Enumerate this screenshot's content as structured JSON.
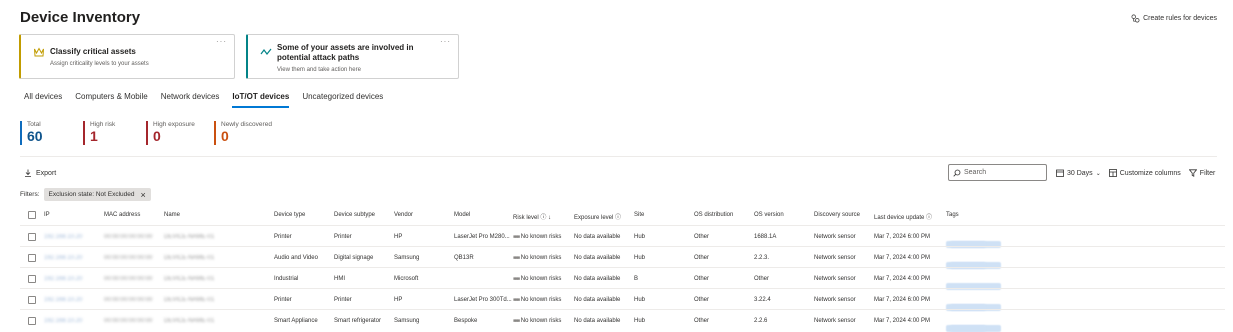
{
  "page": {
    "title": "Device Inventory",
    "create_rules": "Create rules for devices"
  },
  "cards": [
    {
      "title": "Classify critical assets",
      "subtitle": "Assign criticality levels to your assets",
      "accent": "#c19c00",
      "icon": "crown-icon"
    },
    {
      "title": "Some of your assets are involved in potential attack paths",
      "subtitle": "View them and take action here",
      "accent": "#038387",
      "icon": "attack-path-icon"
    }
  ],
  "tabs": [
    "All devices",
    "Computers & Mobile",
    "Network devices",
    "IoT/OT devices",
    "Uncategorized devices"
  ],
  "active_tab": "IoT/OT devices",
  "stats": [
    {
      "label": "Total",
      "value": "60",
      "color": "#0f548c"
    },
    {
      "label": "High risk",
      "value": "1",
      "color": "#a4262c"
    },
    {
      "label": "High exposure",
      "value": "0",
      "color": "#a4262c"
    },
    {
      "label": "Newly discovered",
      "value": "0",
      "color": "#ca5010"
    }
  ],
  "toolbar": {
    "export": "Export",
    "search_placeholder": "Search",
    "days": "30 Days",
    "customize": "Customize columns",
    "filter": "Filter"
  },
  "filters": {
    "label": "Filters:",
    "chip": "Exclusion state: Not Excluded"
  },
  "columns": [
    "IP",
    "MAC address",
    "Name",
    "Device type",
    "Device subtype",
    "Vendor",
    "Model",
    "Risk level",
    "Exposure level",
    "Site",
    "OS distribution",
    "OS version",
    "Discovery source",
    "Last device update",
    "Tags"
  ],
  "rows": [
    {
      "type": "Printer",
      "subtype": "Printer",
      "vendor": "HP",
      "model": "LaserJet Pro M280...",
      "risk": "No known risks",
      "exposure": "No data available",
      "site": "Hub",
      "os": "Other",
      "osver": "1688.1A",
      "source": "Network sensor",
      "updated": "Mar 7, 2024 6:00 PM",
      "tags": 2
    },
    {
      "type": "Audio and Video",
      "subtype": "Digital signage",
      "vendor": "Samsung",
      "model": "QB13R",
      "risk": "No known risks",
      "exposure": "No data available",
      "site": "Hub",
      "os": "Other",
      "osver": "2.2.3.",
      "source": "Network sensor",
      "updated": "Mar 7, 2024 4:00 PM",
      "tags": 2
    },
    {
      "type": "Industrial",
      "subtype": "HMI",
      "vendor": "Microsoft",
      "model": "",
      "risk": "No known risks",
      "exposure": "No data available",
      "site": "B",
      "os": "Other",
      "osver": "Other",
      "source": "Network sensor",
      "updated": "Mar 7, 2024 4:00 PM",
      "tags": 1
    },
    {
      "type": "Printer",
      "subtype": "Printer",
      "vendor": "HP",
      "model": "LaserJet Pro 300Td...",
      "risk": "No known risks",
      "exposure": "No data available",
      "site": "Hub",
      "os": "Other",
      "osver": "3.22.4",
      "source": "Network sensor",
      "updated": "Mar 7, 2024 6:00 PM",
      "tags": 2
    },
    {
      "type": "Smart Appliance",
      "subtype": "Smart refrigerator",
      "vendor": "Samsung",
      "model": "Bespoke",
      "risk": "No known risks",
      "exposure": "No data available",
      "site": "Hub",
      "os": "Other",
      "osver": "2.2.6",
      "source": "Network sensor",
      "updated": "Mar 7, 2024 4:00 PM",
      "tags": 2
    }
  ]
}
